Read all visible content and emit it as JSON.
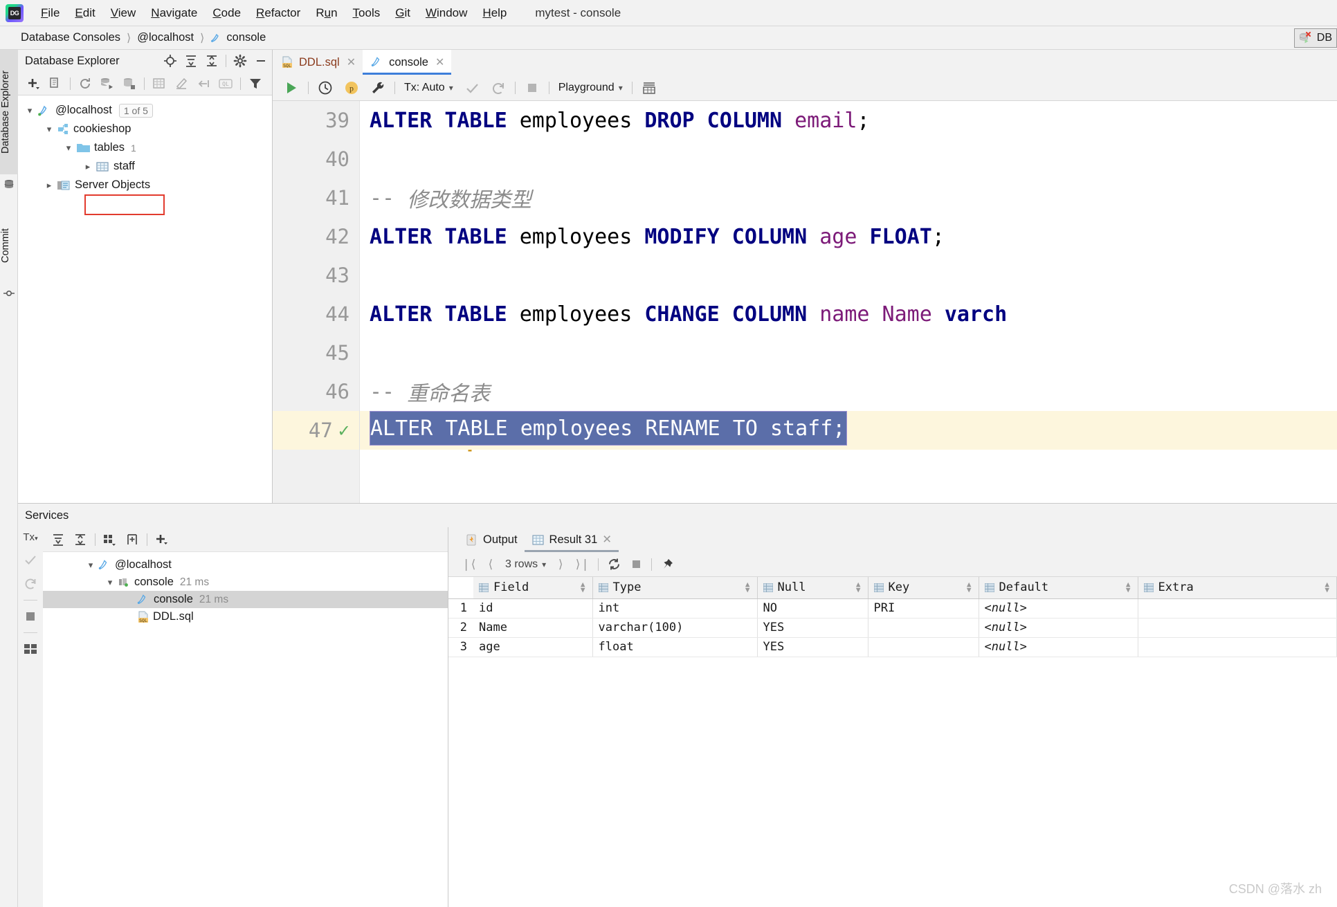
{
  "window": {
    "title": "mytest - console"
  },
  "menubar": {
    "items": [
      {
        "label": "File",
        "mnemonic": "F"
      },
      {
        "label": "Edit",
        "mnemonic": "E"
      },
      {
        "label": "View",
        "mnemonic": "V"
      },
      {
        "label": "Navigate",
        "mnemonic": "N"
      },
      {
        "label": "Code",
        "mnemonic": "C"
      },
      {
        "label": "Refactor",
        "mnemonic": "R"
      },
      {
        "label": "Run",
        "mnemonic": "u"
      },
      {
        "label": "Tools",
        "mnemonic": "T"
      },
      {
        "label": "Git",
        "mnemonic": "G"
      },
      {
        "label": "Window",
        "mnemonic": "W"
      },
      {
        "label": "Help",
        "mnemonic": "H"
      }
    ],
    "logo_text": "DG"
  },
  "breadcrumb": {
    "items": [
      "Database Consoles",
      "@localhost",
      "console"
    ],
    "separator": "›",
    "right_chip": "DB"
  },
  "tool_strip": {
    "tabs": [
      {
        "label": "Database Explorer",
        "icon": "database-icon",
        "active": true
      },
      {
        "label": "Commit",
        "icon": "commit-icon",
        "active": false
      }
    ]
  },
  "database_explorer": {
    "title": "Database Explorer",
    "head_icons": [
      "locate-icon",
      "expand-all-icon",
      "collapse-all-icon",
      "gear-icon",
      "minimize-icon"
    ],
    "toolbar_icons": [
      "add-icon",
      "copy-icon",
      "refresh-icon",
      "run-script-icon",
      "database-tools-icon",
      "table-editor-icon",
      "modify-icon",
      "jump-to-icon",
      "query-icon",
      "filter-icon"
    ],
    "tree": [
      {
        "label": "@localhost",
        "icon": "mysql-icon",
        "badge": "1 of 5",
        "depth": 0,
        "expanded": true
      },
      {
        "label": "cookieshop",
        "icon": "schema-icon",
        "depth": 1,
        "expanded": true
      },
      {
        "label": "tables",
        "icon": "folder-icon",
        "count": "1",
        "depth": 2,
        "expanded": true
      },
      {
        "label": "staff",
        "icon": "table-icon",
        "depth": 3,
        "expanded": false,
        "highlighted": true
      },
      {
        "label": "Server Objects",
        "icon": "server-objects-icon",
        "depth": 1,
        "expanded": false
      }
    ]
  },
  "editor": {
    "tabs": [
      {
        "label": "DDL.sql",
        "icon": "sql-file-icon",
        "active": false,
        "closable": true
      },
      {
        "label": "console",
        "icon": "mysql-icon",
        "active": true,
        "closable": true
      }
    ],
    "toolbar": {
      "run_label": "run-icon",
      "history_label": "history-icon",
      "profile_label": "p",
      "settings_label": "wrench-icon",
      "tx_label": "Tx: Auto",
      "commit_label": "commit-icon",
      "rollback_label": "rollback-icon",
      "stop_label": "stop-icon",
      "schema_label": "Playground",
      "grid_label": "data-editor-icon"
    },
    "lines": [
      {
        "number": "39",
        "tokens": [
          {
            "t": "ALTER TABLE ",
            "c": "kw"
          },
          {
            "t": "employees ",
            "c": "id"
          },
          {
            "t": "DROP COLUMN ",
            "c": "kw"
          },
          {
            "t": "email",
            "c": "col"
          },
          {
            "t": ";",
            "c": "id"
          }
        ]
      },
      {
        "number": "40",
        "tokens": []
      },
      {
        "number": "41",
        "tokens": [
          {
            "t": "-- ",
            "c": "cmt-dash"
          },
          {
            "t": "修改数据类型",
            "c": "cmt"
          }
        ]
      },
      {
        "number": "42",
        "tokens": [
          {
            "t": "ALTER TABLE ",
            "c": "kw"
          },
          {
            "t": "employees ",
            "c": "id"
          },
          {
            "t": "MODIFY COLUMN ",
            "c": "kw"
          },
          {
            "t": "age ",
            "c": "col"
          },
          {
            "t": "FLOAT",
            "c": "kw"
          },
          {
            "t": ";",
            "c": "id"
          }
        ]
      },
      {
        "number": "43",
        "tokens": []
      },
      {
        "number": "44",
        "tokens": [
          {
            "t": "ALTER TABLE ",
            "c": "kw"
          },
          {
            "t": "employees ",
            "c": "id"
          },
          {
            "t": "CHANGE COLUMN ",
            "c": "kw"
          },
          {
            "t": "name Name ",
            "c": "col"
          },
          {
            "t": "varch",
            "c": "kw"
          }
        ]
      },
      {
        "number": "45",
        "tokens": []
      },
      {
        "number": "46",
        "tokens": [
          {
            "t": "-- ",
            "c": "cmt-dash"
          },
          {
            "t": "重命名表",
            "c": "cmt"
          }
        ]
      },
      {
        "number": "47",
        "selected": true,
        "gutter_status": "executed-ok",
        "selected_text": "ALTER TABLE employees RENAME TO staff;",
        "tokens": []
      }
    ]
  },
  "services": {
    "title": "Services",
    "vtoolbar": [
      "Tx",
      "commit-icon",
      "rollback-icon",
      "stop-icon",
      "layout-icon"
    ],
    "toolbar_icons": [
      "expand-all-icon",
      "collapse-all-icon",
      "group-icon",
      "add-tab-icon",
      "add-icon"
    ],
    "tree": [
      {
        "label": "@localhost",
        "icon": "mysql-icon",
        "depth": 0,
        "expanded": true,
        "time": ""
      },
      {
        "label": "console",
        "icon": "connection-icon",
        "depth": 1,
        "expanded": true,
        "time": "21 ms"
      },
      {
        "label": "console",
        "icon": "mysql-icon",
        "depth": 2,
        "time": "21 ms",
        "selected": true
      },
      {
        "label": "DDL.sql",
        "icon": "sql-file-icon",
        "depth": 2,
        "time": ""
      }
    ]
  },
  "results": {
    "tabs": [
      {
        "label": "Output",
        "icon": "output-icon",
        "active": false,
        "closable": false
      },
      {
        "label": "Result 31",
        "icon": "grid-icon",
        "active": true,
        "closable": true
      }
    ],
    "toolbar": {
      "first_page": "❘⟨",
      "prev_page": "⟨",
      "rows_label": "3 rows",
      "next_page": "⟩",
      "last_page": "⟩❘",
      "reload": "refresh-icon",
      "stop": "stop-icon",
      "pin": "pin-icon"
    },
    "grid": {
      "columns": [
        "Field",
        "Type",
        "Null",
        "Key",
        "Default",
        "Extra"
      ],
      "rows": [
        {
          "n": "1",
          "cells": [
            "id",
            "int",
            "NO",
            "PRI",
            "<null>",
            ""
          ]
        },
        {
          "n": "2",
          "cells": [
            "Name",
            "varchar(100)",
            "YES",
            "",
            "<null>",
            ""
          ]
        },
        {
          "n": "3",
          "cells": [
            "age",
            "float",
            "YES",
            "",
            "<null>",
            ""
          ]
        }
      ],
      "null_token": "<null>"
    }
  },
  "watermark": "CSDN @落水 zh",
  "colors": {
    "keyword": "#000080",
    "column": "#7c1a78",
    "comment": "#8c8c8c",
    "selection": "#5b6ea9",
    "highlight_line": "#fdf6dd",
    "accent": "#3d7eda",
    "staff_outline": "#e23b2e"
  }
}
